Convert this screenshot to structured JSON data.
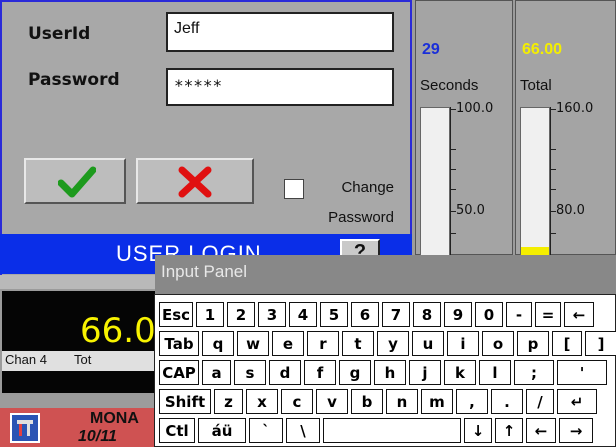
{
  "login": {
    "userid_label": "UserId",
    "userid_value": "Jeff",
    "password_label": "Password",
    "password_value": "*****",
    "change_password_line1": "Change",
    "change_password_line2": "Password",
    "title": "USER LOGIN",
    "help_label": "?"
  },
  "panels": {
    "seconds": {
      "value": "29",
      "label": "Seconds",
      "scale_top": "100.0",
      "scale_mid": "50.0",
      "fill_fraction": 0.0
    },
    "total": {
      "value": "66.00",
      "label": "Total",
      "scale_top": "160.0",
      "scale_mid": "80.0",
      "fill_fraction": 0.06
    }
  },
  "channel": {
    "big_value": "66.0",
    "chan_label": "Chan 4",
    "chan_tot": "Tot"
  },
  "status": {
    "day": "MONA",
    "date": "10/11"
  },
  "input_panel": {
    "title": "Input Panel",
    "rows": [
      [
        "Esc",
        "1",
        "2",
        "3",
        "4",
        "5",
        "6",
        "7",
        "8",
        "9",
        "0",
        "-",
        "=",
        "←"
      ],
      [
        "Tab",
        "q",
        "w",
        "e",
        "r",
        "t",
        "y",
        "u",
        "i",
        "o",
        "p",
        "[",
        "]"
      ],
      [
        "CAP",
        "a",
        "s",
        "d",
        "f",
        "g",
        "h",
        "j",
        "k",
        "l",
        ";",
        "'"
      ],
      [
        "Shift",
        "z",
        "x",
        "c",
        "v",
        "b",
        "n",
        "m",
        ",",
        ".",
        "/",
        "↵"
      ],
      [
        "Ctl",
        "áü",
        "`",
        "\\",
        "",
        "↓",
        "↑",
        "←",
        "→"
      ]
    ]
  },
  "colors": {
    "title_bar": "#0a2ee8",
    "ok_check": "#1d9a1d",
    "cancel_x": "#e01010",
    "seconds_value": "#1a2fd9",
    "total_value": "#f4ee00",
    "status_bar": "#cf5252"
  }
}
